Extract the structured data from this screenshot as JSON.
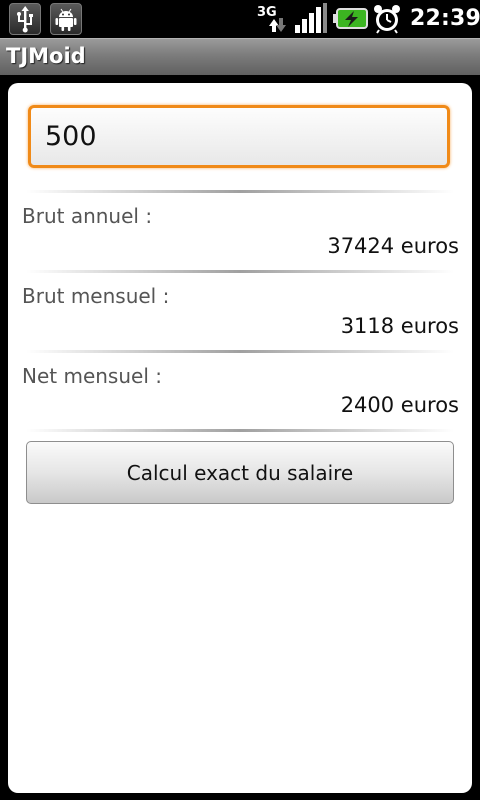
{
  "status_bar": {
    "time": "22:39",
    "network_type": "3G",
    "icons": [
      "usb-icon",
      "android-debug-icon",
      "3g-data-icon",
      "signal-strength-icon",
      "battery-charging-icon",
      "alarm-clock-icon"
    ],
    "battery_color": "#3cb521"
  },
  "app": {
    "title": "TJMoid"
  },
  "form": {
    "amount_value": "500"
  },
  "results": [
    {
      "label": "Brut annuel :",
      "value": "37424 euros"
    },
    {
      "label": "Brut mensuel :",
      "value": "3118 euros"
    },
    {
      "label": "Net mensuel :",
      "value": "2400 euros"
    }
  ],
  "button": {
    "label": "Calcul exact du salaire"
  },
  "colors": {
    "input_focus_border": "#f08a18",
    "title_bar": "#7c7c7c"
  }
}
